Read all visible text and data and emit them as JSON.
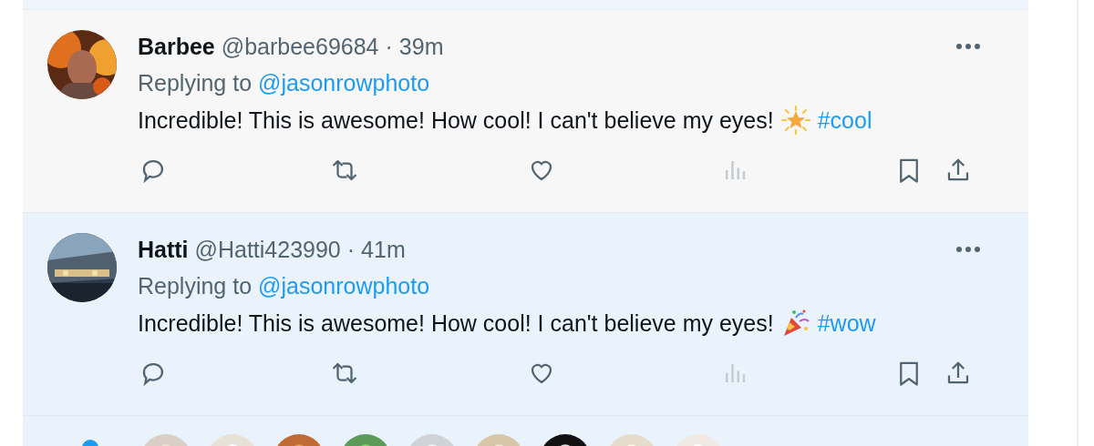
{
  "tweets": [
    {
      "name": "Barbee",
      "handle": "@barbee69684",
      "separator": "·",
      "time": "39m",
      "replying_label": "Replying to",
      "replying_to": "@jasonrowphoto",
      "text": "Incredible! This is awesome! How cool! I can't believe my eyes!",
      "emoji": {
        "kind": "star"
      },
      "hashtag": "#cool",
      "highlighted": false
    },
    {
      "name": "Hatti",
      "handle": "@Hatti423990",
      "separator": "·",
      "time": "41m",
      "replying_label": "Replying to",
      "replying_to": "@jasonrowphoto",
      "text": "Incredible! This is awesome! How cool! I can't believe my eyes!",
      "emoji": {
        "kind": "party"
      },
      "hashtag": "#wow",
      "highlighted": true
    }
  ]
}
